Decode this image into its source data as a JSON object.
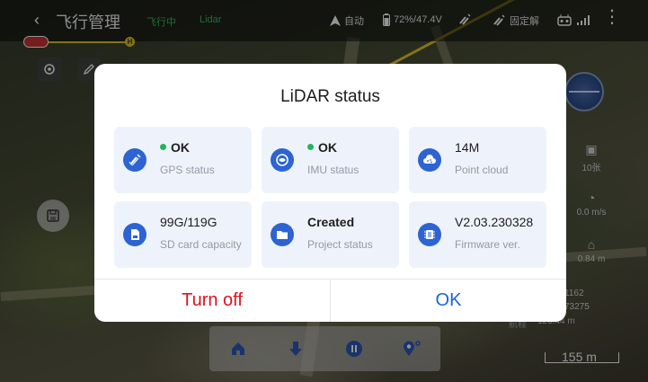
{
  "topbar": {
    "title": "飞行管理",
    "flight_status": "飞行中",
    "lidar_link": "Lidar",
    "mode": "自动",
    "battery": "72%/47.4V",
    "rtk_fix": "固定解"
  },
  "timeline": {
    "home_marker": "H"
  },
  "right_panel": {
    "photo_count": "10张",
    "speed": "0.0 m/s",
    "height": "0.84 m",
    "coord_1": "1162",
    "coord_2": "73275",
    "distance_label": "航程",
    "distance": "126.44 m",
    "scale": "155 m"
  },
  "modal": {
    "title": "LiDAR status",
    "cards": [
      {
        "value": "OK",
        "label": "GPS status",
        "status_dot": true,
        "bold": true,
        "icon": "satellite-icon"
      },
      {
        "value": "OK",
        "label": "IMU status",
        "status_dot": true,
        "bold": true,
        "icon": "imu-icon"
      },
      {
        "value": "14M",
        "label": "Point cloud",
        "status_dot": false,
        "bold": false,
        "icon": "cloud-icon"
      },
      {
        "value": "99G/119G",
        "label": "SD card capacity",
        "status_dot": false,
        "bold": false,
        "icon": "sd-card-icon"
      },
      {
        "value": "Created",
        "label": "Project status",
        "status_dot": false,
        "bold": true,
        "icon": "folder-icon"
      },
      {
        "value": "V2.03.230328",
        "label": "Firmware ver.",
        "status_dot": false,
        "bold": false,
        "icon": "firmware-icon"
      }
    ],
    "turn_off_label": "Turn off",
    "ok_label": "OK"
  },
  "colors": {
    "accent_blue": "#2d63d3",
    "ok_green": "#24b35b",
    "danger_red": "#e0101e",
    "card_bg": "#eef3fb"
  }
}
